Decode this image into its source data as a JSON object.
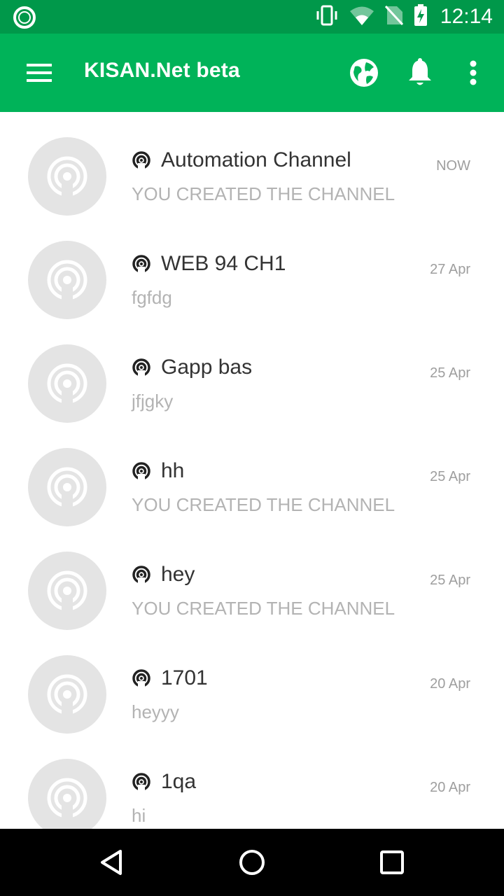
{
  "status_bar": {
    "time": "12:14",
    "icons": [
      "app-ring-icon",
      "vibrate-icon",
      "wifi-icon",
      "no-sim-icon",
      "battery-charging-icon"
    ]
  },
  "app_bar": {
    "title": "KISAN.Net beta",
    "icons": [
      "menu-icon",
      "globe-icon",
      "bell-icon",
      "more-vert-icon"
    ]
  },
  "channels": [
    {
      "name": "Automation Channel",
      "subtitle": "YOU CREATED THE CHANNEL",
      "time": "NOW"
    },
    {
      "name": "WEB 94 CH1",
      "subtitle": "fgfdg",
      "time": "27 Apr"
    },
    {
      "name": "Gapp bas",
      "subtitle": "jfjgky",
      "time": "25 Apr"
    },
    {
      "name": "hh",
      "subtitle": "YOU CREATED THE CHANNEL",
      "time": "25 Apr"
    },
    {
      "name": "hey",
      "subtitle": "YOU CREATED THE CHANNEL",
      "time": "25 Apr"
    },
    {
      "name": "1701",
      "subtitle": "heyyy",
      "time": "20 Apr"
    },
    {
      "name": "1qa",
      "subtitle": "hi",
      "time": "20 Apr"
    }
  ],
  "nav_bar": {
    "icons": [
      "back-icon",
      "home-icon",
      "recents-icon"
    ]
  },
  "colors": {
    "status_bar": "#00984a",
    "app_bar": "#00b359",
    "avatar_bg": "#e4e4e4",
    "subtitle": "#b3b3b3"
  }
}
